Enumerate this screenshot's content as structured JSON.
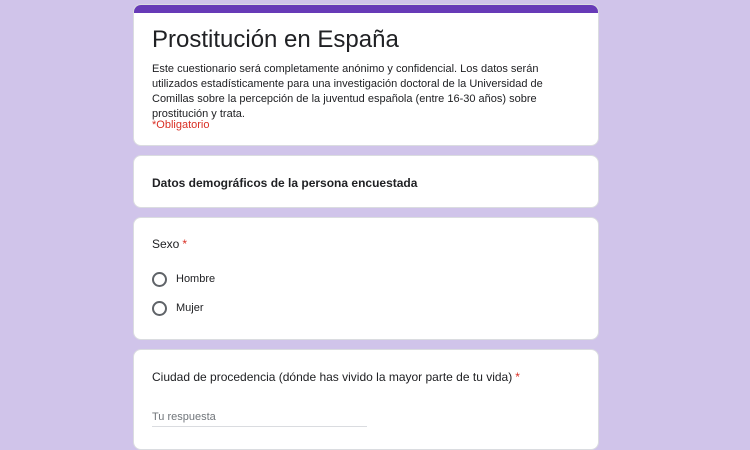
{
  "form": {
    "title": "Prostitución en España",
    "description": "Este cuestionario será completamente anónimo y confidencial. Los datos serán utilizados estadísticamente para una investigación doctoral de la Universidad de Comillas sobre la percepción de la juventud española (entre 16-30 años) sobre prostitución y trata.",
    "required_note": "*Obligatorio",
    "accent_color": "#673ab7",
    "background_color": "#d0c4ea"
  },
  "section": {
    "title": "Datos demográficos de la persona encuestada"
  },
  "questions": {
    "sexo": {
      "title": "Sexo",
      "required_mark": "*",
      "options": [
        "Hombre",
        "Mujer"
      ]
    },
    "ciudad": {
      "title": "Ciudad de procedencia (dónde has vivido la mayor parte de tu vida)",
      "required_mark": "*",
      "placeholder": "Tu respuesta",
      "value": ""
    }
  }
}
